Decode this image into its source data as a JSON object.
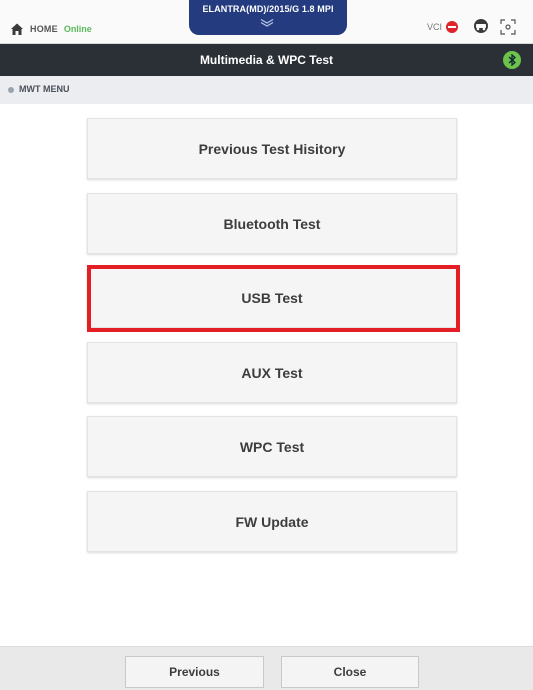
{
  "header": {
    "home_label": "HOME",
    "status": "Online",
    "vehicle": "ELANTRA(MD)/2015/G 1.8 MPI",
    "vci_label": "VCI",
    "icons": [
      "home-icon",
      "chevron-down-icon",
      "vci-disconnected-icon",
      "vehicle-icon",
      "focus-icon"
    ]
  },
  "title_bar": {
    "title": "Multimedia & WPC Test",
    "bluetooth_icon": "bluetooth-icon"
  },
  "section": {
    "title": "MWT MENU"
  },
  "menu": {
    "items": [
      {
        "label": "Previous Test Hisitory"
      },
      {
        "label": "Bluetooth Test"
      },
      {
        "label": "USB Test"
      },
      {
        "label": "AUX Test"
      },
      {
        "label": "WPC Test"
      },
      {
        "label": "FW Update"
      }
    ],
    "highlighted_item": "USB Test",
    "highlight_color": "#e31e24"
  },
  "footer": {
    "previous_label": "Previous",
    "close_label": "Close"
  },
  "colors": {
    "vehicle_tab": "#243b80",
    "title_bar": "#2b2f36",
    "online": "#5cb85c",
    "vci_status": "#e0242b",
    "bluetooth": "#6cc24a"
  }
}
